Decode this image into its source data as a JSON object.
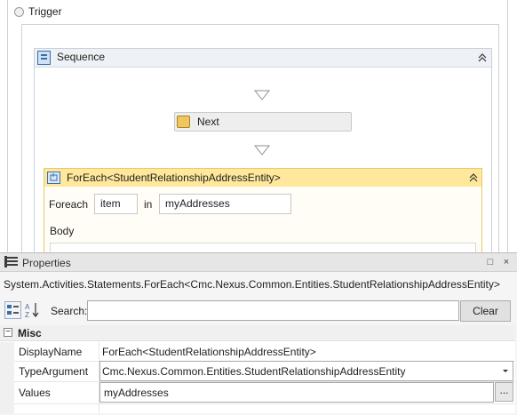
{
  "designer": {
    "trigger_label": "Trigger",
    "sequence_label": "Sequence",
    "next_label": "Next",
    "foreach_title": "ForEach<StudentRelationshipAddressEntity>",
    "foreach_keyword": "Foreach",
    "item_value": "item",
    "in_keyword": "in",
    "values_expr": "myAddresses",
    "body_label": "Body",
    "collapse_glyph": "«"
  },
  "properties": {
    "title": "Properties",
    "type_name": "System.Activities.Statements.ForEach<Cmc.Nexus.Common.Entities.StudentRelationshipAddressEntity>",
    "search_label": "Search:",
    "search_value": "",
    "clear_label": "Clear",
    "category": {
      "label": "Misc",
      "toggle": "−"
    },
    "rows": [
      {
        "name": "DisplayName",
        "value": "ForEach<StudentRelationshipAddressEntity>"
      },
      {
        "name": "TypeArgument",
        "value": "Cmc.Nexus.Common.Entities.StudentRelationshipAddressEntity"
      },
      {
        "name": "Values",
        "value": "myAddresses"
      }
    ],
    "ellipsis_label": "...",
    "window_buttons": {
      "maximize": "□",
      "close": "×"
    }
  },
  "colors": {
    "foreach_header": "#ffe89b",
    "foreach_border": "#e8c86b",
    "sequence_header": "#eef1f5",
    "panel_bg": "#f5f5f5"
  },
  "icons": {
    "sequence": "sequence-icon",
    "next": "activity-icon",
    "foreach": "foreach-icon",
    "properties": "properties-list-icon",
    "categorized": "categorized-view-icon",
    "alphabetical": "sort-alphabetical-icon"
  }
}
